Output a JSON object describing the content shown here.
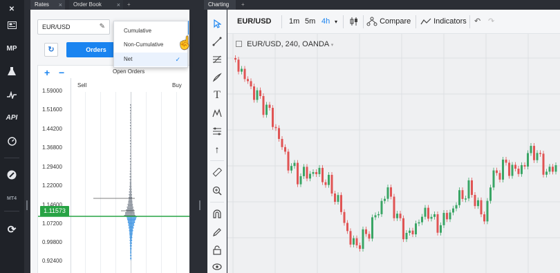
{
  "left_tabs": [
    {
      "label": "Rates",
      "active": true
    },
    {
      "label": "Order Book",
      "active": false
    }
  ],
  "add_tab": "+",
  "right_tabs": [
    {
      "label": "Charting",
      "active": true
    }
  ],
  "rail": {
    "mp_label": "MP",
    "api_label": "API",
    "mt4_label": "MT4"
  },
  "orderbook": {
    "pair": "EUR/USD",
    "orders_button": "Orders",
    "panel_title": "Open Orders",
    "sell_label": "Sell",
    "buy_label": "Buy",
    "zoom_in": "+",
    "zoom_out": "−",
    "price_levels": [
      "1.59000",
      "1.51600",
      "1.44200",
      "1.36800",
      "1.29400",
      "1.22000",
      "1.14600",
      "1.07200",
      "0.99800",
      "0.92400"
    ],
    "current_price": "1.11573",
    "colors": {
      "sell": "#7d8590",
      "buy": "#2a8ae0",
      "current_line": "#27a344"
    }
  },
  "dropdown": {
    "options": [
      {
        "label": "Cumulative",
        "selected": false
      },
      {
        "label": "Non-Cumulative",
        "selected": false
      },
      {
        "label": "Net",
        "selected": true
      }
    ],
    "check_mark": "✓"
  },
  "chart_toolbar": {
    "symbol": "EUR/USD",
    "intervals": [
      "1m",
      "5m",
      "4h"
    ],
    "active_interval": "4h",
    "compare_label": "Compare",
    "indicators_label": "Indicators",
    "undo_icon": "undo-icon",
    "redo_icon": "redo-icon"
  },
  "chart": {
    "legend": "EUR/USD, 240, OANDA",
    "colors": {
      "up": "#3aa565",
      "down": "#e05454",
      "grid": "#dcdfe3"
    }
  }
}
